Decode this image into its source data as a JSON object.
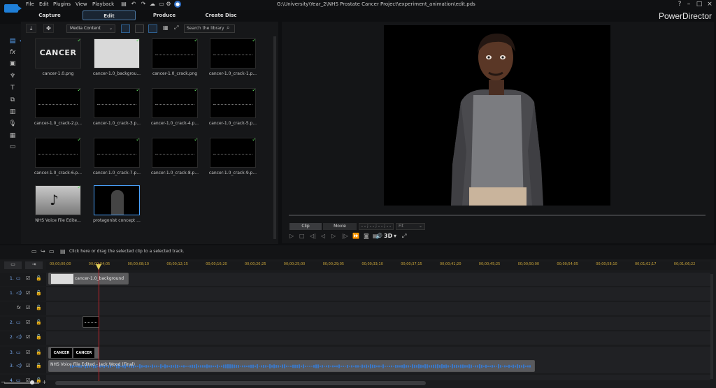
{
  "menu": [
    "File",
    "Edit",
    "Plugins",
    "View",
    "Playback"
  ],
  "document_path": "G:\\University\\Year_2\\NHS Prostate Cancer Project\\experiment_animation\\edit.pds",
  "modes": [
    "Capture",
    "Edit",
    "Produce",
    "Create Disc"
  ],
  "brand": "PowerDirector",
  "library": {
    "dropdown": "Media Content",
    "search_placeholder": "Search the library",
    "items": [
      {
        "label": "cancer-1.0.png",
        "kind": "cancer"
      },
      {
        "label": "cancer-1.0_backgrou...",
        "kind": "white"
      },
      {
        "label": "cancer-1.0_crack.png",
        "kind": "crack"
      },
      {
        "label": "cancer-1.0_crack-1.p...",
        "kind": "crack"
      },
      {
        "label": "cancer-1.0_crack-2.p...",
        "kind": "crack"
      },
      {
        "label": "cancer-1.0_crack-3.p...",
        "kind": "crack"
      },
      {
        "label": "cancer-1.0_crack-4.p...",
        "kind": "crack"
      },
      {
        "label": "cancer-1.0_crack-5.p...",
        "kind": "crack"
      },
      {
        "label": "cancer-1.0_crack-6.p...",
        "kind": "crack"
      },
      {
        "label": "cancer-1.0_crack-7.p...",
        "kind": "crack"
      },
      {
        "label": "cancer-1.0_crack-8.p...",
        "kind": "crack"
      },
      {
        "label": "cancer-1.0_crack-9.p...",
        "kind": "crack"
      },
      {
        "label": "NHS Voice File Edite...",
        "kind": "audio"
      },
      {
        "label": "protagonist concept ...",
        "kind": "person"
      }
    ],
    "cancer_thumb_text": "CANCER"
  },
  "preview": {
    "clip_label": "Clip",
    "movie_label": "Movie",
    "timecode": "- - ; - - ; - - ; - -",
    "fit": "Fit",
    "three_d": "3D"
  },
  "hint": "Click here or drag the selected clip to a selected track.",
  "timeline": {
    "ruler": [
      "00;00;00;00",
      "00;00;04;05",
      "00;00;08;10",
      "00;00;12;15",
      "00;00;16;20",
      "00;00;20;25",
      "00;00;25;00",
      "00;00;29;05",
      "00;00;33;10",
      "00;00;37;15",
      "00;00;41;20",
      "00;00;45;25",
      "00;00;50;00",
      "00;00;54;05",
      "00;00;58;10",
      "00;01;02;17",
      "00;01;06;22"
    ],
    "tracks": [
      "1.",
      "1.",
      "fx",
      "2.",
      "2.",
      "3.",
      "3.",
      "4."
    ],
    "clip_bg_label": "cancer-1.0_background",
    "clip_cancer_label": "CANCER",
    "clip_audio_label": "NHS Voice File Edited - Jack Wood (Final)"
  }
}
